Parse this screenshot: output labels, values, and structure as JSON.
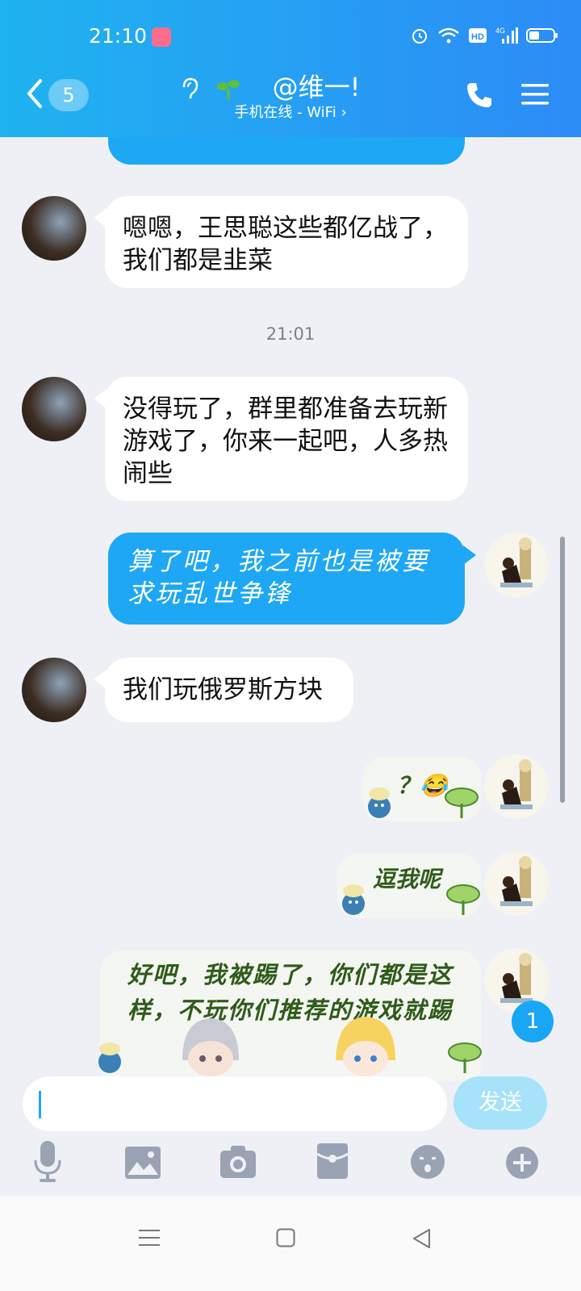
{
  "status": {
    "time": "21:10"
  },
  "header": {
    "back_count": "5",
    "title": "@维一!",
    "subtitle": "手机在线 - WiFi ›"
  },
  "messages": [
    {
      "kind": "in",
      "text": "嗯嗯，王思聪这些都亿战了，我们都是韭菜"
    },
    {
      "kind": "in",
      "text": "没得玩了，群里都准备去玩新游戏了，你来一起吧，人多热闹些"
    },
    {
      "kind": "out",
      "text": "算了吧，我之前也是被要求玩乱世争锋"
    },
    {
      "kind": "in",
      "text": "我们玩俄罗斯方块"
    },
    {
      "kind": "out-sticker",
      "text": "？😂"
    },
    {
      "kind": "out-sticker",
      "text": "逗我呢"
    },
    {
      "kind": "out-sticker",
      "text": "好吧，我被踢了，你们都是这样，不玩你们推荐的游戏就踢"
    }
  ],
  "timestamp": "21:01",
  "unread_badge": "1",
  "composer": {
    "send_label": "发送"
  },
  "icons": {
    "toolbar": [
      "microphone-icon",
      "image-icon",
      "camera-icon",
      "red-packet-icon",
      "emoji-icon",
      "plus-icon"
    ],
    "nav": [
      "menu-icon",
      "home-icon",
      "back-icon"
    ]
  },
  "colors": {
    "header": "#1fb3f0",
    "outgoing_bubble": "#1ea7f5",
    "incoming_bubble": "#ffffff",
    "background": "#eef0f6"
  }
}
